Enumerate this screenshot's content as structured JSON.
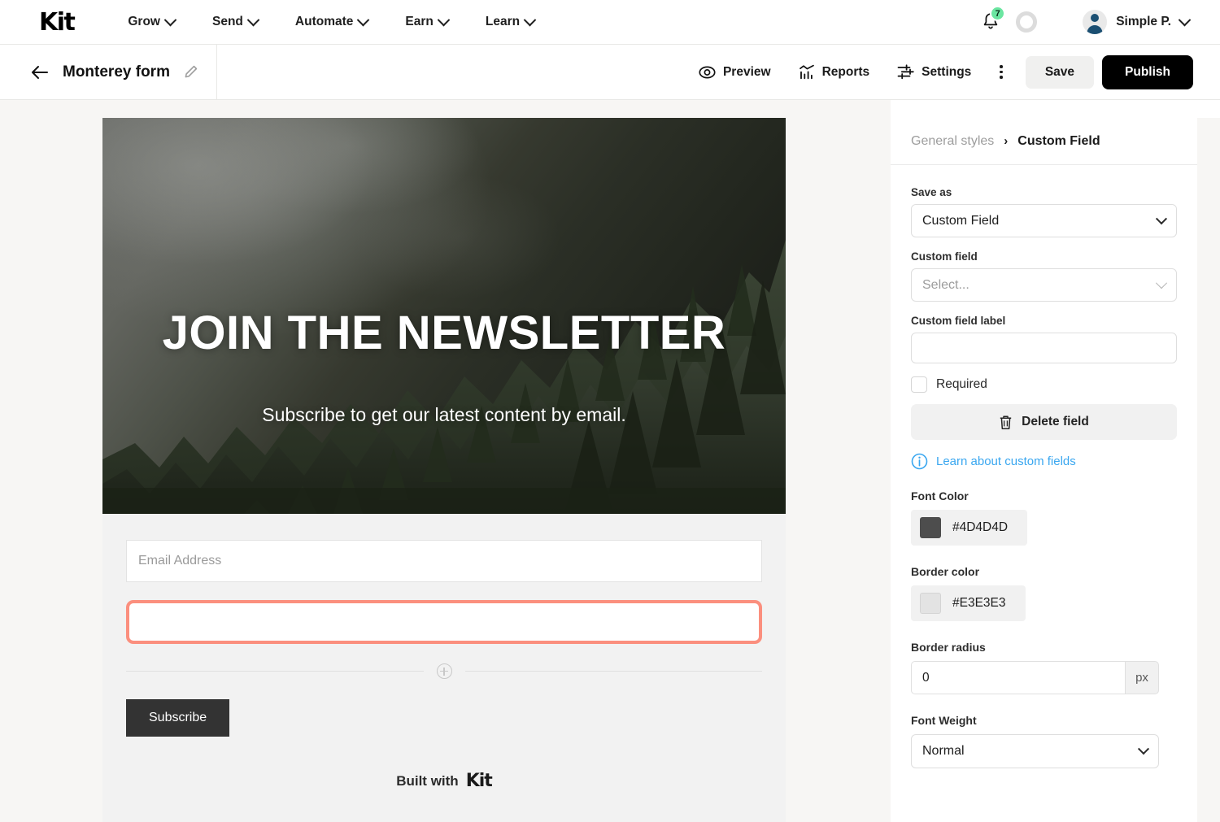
{
  "topnav": {
    "brand": "Kit",
    "items": [
      {
        "label": "Grow",
        "icon": "chevron-down-icon"
      },
      {
        "label": "Send",
        "icon": "chevron-down-icon"
      },
      {
        "label": "Automate",
        "icon": "chevron-down-icon"
      },
      {
        "label": "Earn",
        "icon": "chevron-down-icon"
      },
      {
        "label": "Learn",
        "icon": "chevron-down-icon"
      }
    ],
    "notifications": {
      "icon": "bell-icon",
      "count": "7",
      "badge_color": "#6BE6A1"
    },
    "progress_ring": {
      "icon": "progress-ring-icon"
    },
    "user": {
      "name": "Simple P.",
      "avatar_icon": "user-avatar-icon",
      "caret_icon": "chevron-down-icon"
    }
  },
  "toolbar": {
    "back_icon": "arrow-left-icon",
    "form_title": "Monterey form",
    "edit_icon": "pencil-icon",
    "actions": [
      {
        "label": "Preview",
        "icon": "eye-icon"
      },
      {
        "label": "Reports",
        "icon": "chart-icon"
      },
      {
        "label": "Settings",
        "icon": "sliders-icon"
      }
    ],
    "more_icon": "kebab-menu-icon",
    "save_label": "Save",
    "publish_label": "Publish"
  },
  "form_preview": {
    "hero": {
      "headline": "JOIN THE NEWSLETTER",
      "subheadline": "Subscribe to get our latest content by email.",
      "background_image": "misty-forest-photo"
    },
    "fields": [
      {
        "placeholder": "Email Address",
        "name": "email-field",
        "selected": false
      },
      {
        "placeholder": "",
        "name": "custom-field",
        "selected": true
      }
    ],
    "add_field_icon": "plus-circle-icon",
    "submit_label": "Subscribe",
    "footer": {
      "prefix": "Built with",
      "brand": "Kit"
    },
    "selected_outline_color": "#FB8F7E"
  },
  "panel": {
    "breadcrumb": {
      "parent": "General styles",
      "separator": "›",
      "current": "Custom Field"
    },
    "save_as": {
      "label": "Save as",
      "value": "Custom Field",
      "caret_icon": "chevron-down-icon"
    },
    "custom_field": {
      "label": "Custom field",
      "placeholder": "Select...",
      "value": "",
      "caret_icon": "chevron-down-icon"
    },
    "custom_field_label": {
      "label": "Custom field label",
      "value": "",
      "placeholder": ""
    },
    "required": {
      "label": "Required",
      "checked": false
    },
    "delete_field": {
      "label": "Delete field",
      "icon": "trash-icon"
    },
    "learn_link": {
      "label": "Learn about custom fields",
      "icon": "info-icon",
      "color": "#3AA7F0"
    },
    "font_color": {
      "label": "Font Color",
      "value": "#4D4D4D",
      "swatch": "#4D4D4D"
    },
    "border_color": {
      "label": "Border color",
      "value": "#E3E3E3",
      "swatch": "#E3E3E3"
    },
    "border_radius": {
      "label": "Border radius",
      "value": "0",
      "unit": "px"
    },
    "font_weight": {
      "label": "Font Weight",
      "value": "Normal",
      "caret_icon": "chevron-down-icon"
    }
  }
}
